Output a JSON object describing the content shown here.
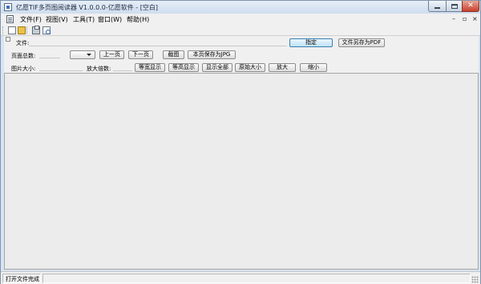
{
  "window": {
    "title": "亿愿TIF多页图阅读器 V1.0.0.0-亿愿软件 - [空白]",
    "controls": {
      "minimize": "–",
      "restore": "▫",
      "close": "✕"
    }
  },
  "menubar": {
    "items": [
      "文件(F)",
      "视图(V)",
      "工具(T)",
      "窗口(W)",
      "帮助(H)"
    ],
    "mdi_controls": {
      "minimize": "–",
      "restore": "▫",
      "close": "×"
    }
  },
  "toolbar": {
    "icons": [
      "new-icon",
      "open-icon",
      "print-icon",
      "print-preview-icon"
    ]
  },
  "form": {
    "file_label": "文件:",
    "file_value": "",
    "specify_button": "指定",
    "save_pdf_button": "文件另存为PDF",
    "page_count_label": "页面总数:",
    "page_count_value": "",
    "page_select_value": "",
    "prev_page_button": "上一页",
    "next_page_button": "下一页",
    "screenshot_button": "截图",
    "save_jpg_button": "本页保存为JPG",
    "image_size_label": "图片大小:",
    "image_size_value": "",
    "zoom_label": "放大倍数:",
    "zoom_value": "",
    "fit_width_button": "等宽显示",
    "fit_height_button": "等高显示",
    "fit_all_button": "显示全部",
    "original_size_button": "原始大小",
    "zoom_in_button": "放大",
    "zoom_out_button": "缩小"
  },
  "statusbar": {
    "message": "打开文件完成",
    "secondary": ""
  }
}
